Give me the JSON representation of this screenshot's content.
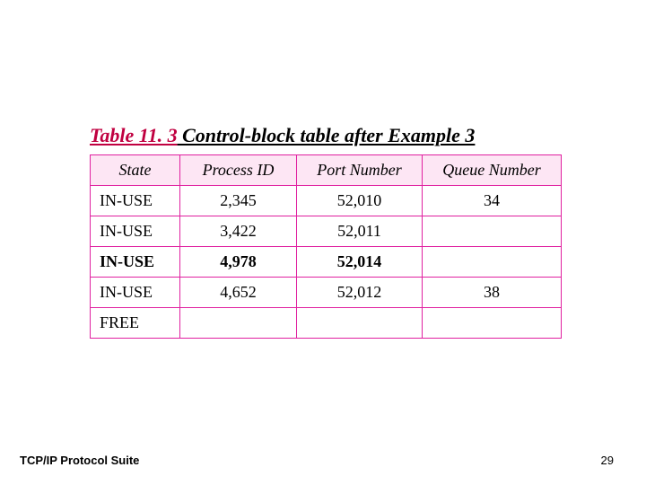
{
  "caption": {
    "tableref": "Table 11. 3",
    "desc": "  Control-block table after Example 3"
  },
  "table": {
    "headers": [
      "State",
      "Process ID",
      "Port Number",
      "Queue Number"
    ],
    "rows": [
      {
        "state": "IN-USE",
        "pid": "2,345",
        "port": "52,010",
        "queue": "34",
        "bold": false
      },
      {
        "state": "IN-USE",
        "pid": "3,422",
        "port": "52,011",
        "queue": "",
        "bold": false
      },
      {
        "state": "IN-USE",
        "pid": "4,978",
        "port": "52,014",
        "queue": "",
        "bold": true
      },
      {
        "state": "IN-USE",
        "pid": "4,652",
        "port": "52,012",
        "queue": "38",
        "bold": false
      },
      {
        "state": "FREE",
        "pid": "",
        "port": "",
        "queue": "",
        "bold": false
      }
    ]
  },
  "footer": {
    "left": "TCP/IP Protocol Suite",
    "rightPage": "29"
  }
}
